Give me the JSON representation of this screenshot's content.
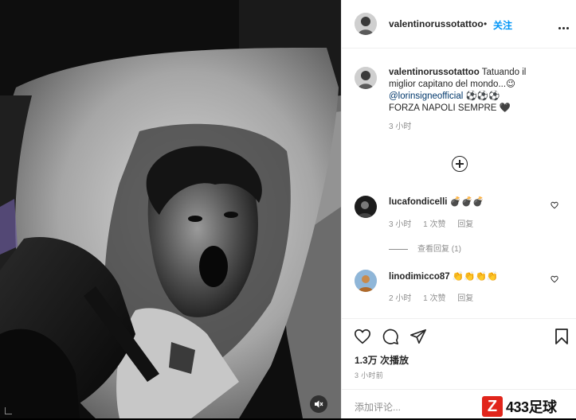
{
  "header": {
    "username": "valentinorussotattoo",
    "separator": "•",
    "follow_label": "关注"
  },
  "caption": {
    "username": "valentinorussotattoo",
    "text_line1": "Tatuando il",
    "text_line2": "miglior capitano del mondo...😉",
    "mention": "@lorinsigneofficial",
    "balls": "⚽⚽⚽",
    "text_line4": "FORZA NAPOLI SEMPRE 🖤",
    "time": "3 小时"
  },
  "comments": [
    {
      "username": "lucafondicelli",
      "text": "💣💣💣",
      "time": "3 小时",
      "likes": "1 次赞",
      "reply_label": "回复",
      "view_replies": "查看回复 (1)"
    },
    {
      "username": "linodimicco87",
      "text": "👏👏👏👏",
      "time": "2 小时",
      "likes": "1 次赞",
      "reply_label": "回复"
    }
  ],
  "footer": {
    "likes": "1.3万 次播放",
    "posted": "3 小时前",
    "add_comment_placeholder": "添加评论...",
    "watermark": "433足球",
    "watermark_z": "Z"
  },
  "colors": {
    "accent_blue": "#0095f6",
    "mention_blue": "#00376b",
    "muted_gray": "#8e8e8e",
    "watermark_red": "#e1251b"
  }
}
